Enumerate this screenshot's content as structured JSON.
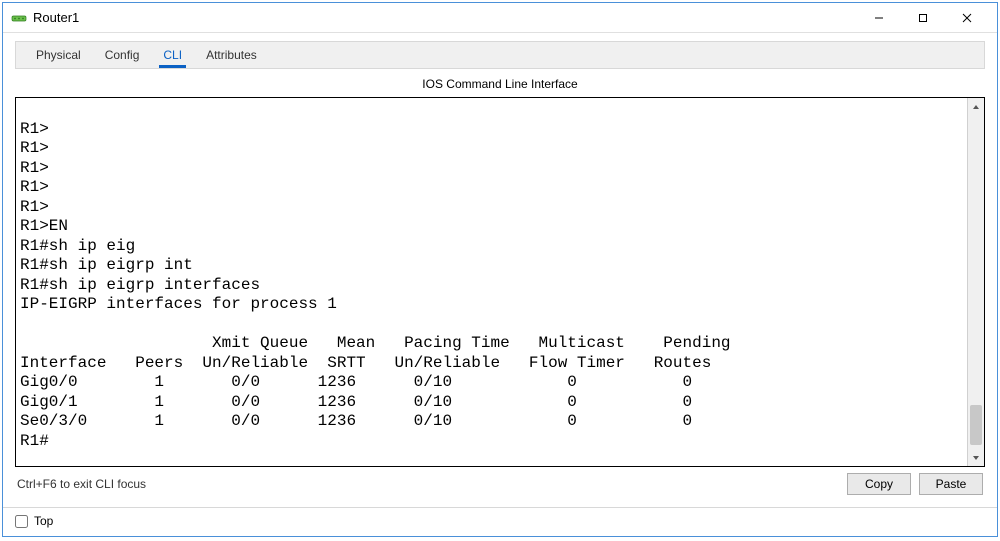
{
  "window": {
    "title": "Router1"
  },
  "tabs": {
    "physical": "Physical",
    "config": "Config",
    "cli": "CLI",
    "attributes": "Attributes",
    "active": "cli"
  },
  "cli": {
    "header": "IOS Command Line Interface",
    "lines": [
      "",
      "R1>",
      "R1>",
      "R1>",
      "R1>",
      "R1>",
      "R1>EN",
      "R1#sh ip eig",
      "R1#sh ip eigrp int",
      "R1#sh ip eigrp interfaces",
      "IP-EIGRP interfaces for process 1",
      "",
      "                    Xmit Queue   Mean   Pacing Time   Multicast    Pending",
      "Interface   Peers  Un/Reliable  SRTT   Un/Reliable   Flow Timer   Routes",
      "Gig0/0        1       0/0      1236      0/10            0           0",
      "Gig0/1        1       0/0      1236      0/10            0           0",
      "Se0/3/0       1       0/0      1236      0/10            0           0",
      "R1#"
    ],
    "hint": "Ctrl+F6 to exit CLI focus",
    "copy_label": "Copy",
    "paste_label": "Paste"
  },
  "bottom": {
    "top_label": "Top",
    "top_checked": false
  }
}
